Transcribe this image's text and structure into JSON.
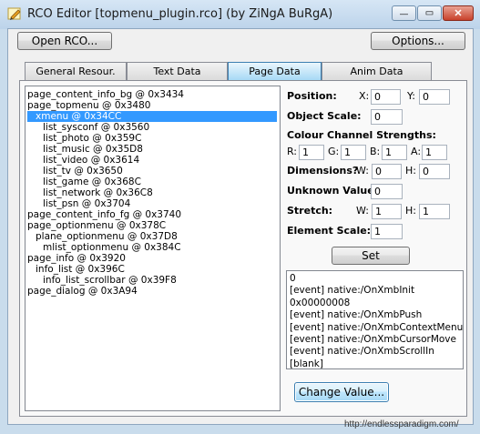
{
  "window": {
    "title": "RCO Editor [topmenu_plugin.rco] (by ZiNgA BuRgA)",
    "controls": {
      "minimize": "—",
      "maximize": "▭",
      "close": "✕"
    }
  },
  "toolbar": {
    "open_label": "Open RCO...",
    "options_label": "Options..."
  },
  "tabs": [
    {
      "label": "General Resour.",
      "active": false
    },
    {
      "label": "Text Data",
      "active": false
    },
    {
      "label": "Page Data",
      "active": true
    },
    {
      "label": "Anim Data",
      "active": false
    }
  ],
  "tree": {
    "items": [
      {
        "label": "page_content_info_bg @ 0x3434",
        "level": 0
      },
      {
        "label": "page_topmenu @ 0x3480",
        "level": 0
      },
      {
        "label": "xmenu @ 0x34CC",
        "level": 1,
        "selected": true
      },
      {
        "label": "list_sysconf @ 0x3560",
        "level": 2
      },
      {
        "label": "list_photo @ 0x359C",
        "level": 2
      },
      {
        "label": "list_music @ 0x35D8",
        "level": 2
      },
      {
        "label": "list_video @ 0x3614",
        "level": 2
      },
      {
        "label": "list_tv @ 0x3650",
        "level": 2
      },
      {
        "label": "list_game @ 0x368C",
        "level": 2
      },
      {
        "label": "list_network @ 0x36C8",
        "level": 2
      },
      {
        "label": "list_psn @ 0x3704",
        "level": 2
      },
      {
        "label": "page_content_info_fg @ 0x3740",
        "level": 0
      },
      {
        "label": "page_optionmenu @ 0x378C",
        "level": 0
      },
      {
        "label": "plane_optionmenu @ 0x37D8",
        "level": 1
      },
      {
        "label": "mlist_optionmenu @ 0x384C",
        "level": 2
      },
      {
        "label": "page_info @ 0x3920",
        "level": 0
      },
      {
        "label": "info_list @ 0x396C",
        "level": 1
      },
      {
        "label": "info_list_scrollbar @ 0x39F8",
        "level": 2
      },
      {
        "label": "page_dialog @ 0x3A94",
        "level": 0
      }
    ]
  },
  "props": {
    "position_label": "Position:",
    "x_label": "X:",
    "y_label": "Y:",
    "pos_x": "0",
    "pos_y": "0",
    "scale_label": "Object Scale:",
    "scale": "0",
    "colour_label": "Colour Channel Strengths:",
    "r_label": "R:",
    "g_label": "G:",
    "b_label": "B:",
    "a_label": "A:",
    "r": "1",
    "g": "1",
    "b": "1",
    "a": "1",
    "dim_label": "Dimensions?",
    "w_label": "W:",
    "h_label": "H:",
    "dim_w": "0",
    "dim_h": "0",
    "unknown_label": "Unknown Value:",
    "unknown": "0",
    "stretch_label": "Stretch:",
    "stretch_w": "1",
    "stretch_h": "1",
    "elem_scale_label": "Element Scale:",
    "elem_scale": "1",
    "set_label": "Set"
  },
  "events": [
    "0",
    "[event] native:/OnXmbInit",
    "0x00000008",
    "[event] native:/OnXmbPush",
    "[event] native:/OnXmbContextMenu",
    "[event] native:/OnXmbCursorMove",
    "[event] native:/OnXmbScrollIn",
    "[blank]"
  ],
  "change_value_label": "Change Value...",
  "status_text": "http://endlessparadigm.com/"
}
